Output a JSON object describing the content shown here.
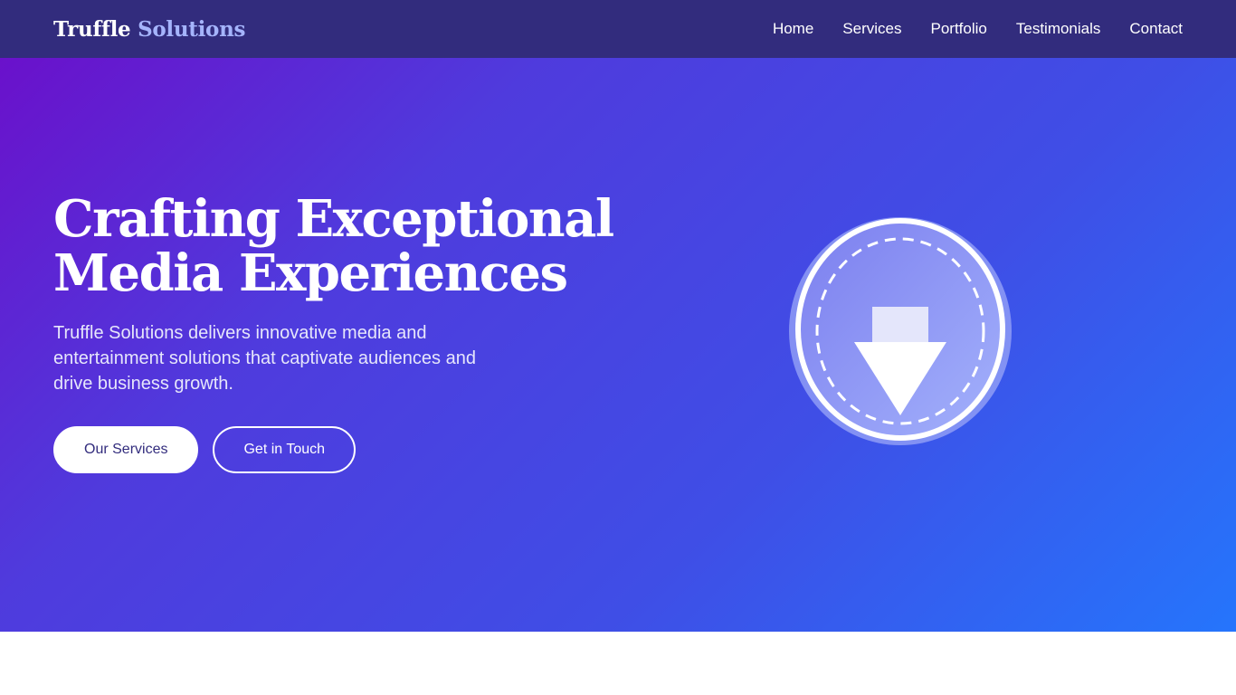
{
  "brand": {
    "name_main": "Truffle",
    "name_accent": "Solutions"
  },
  "nav": {
    "items": [
      {
        "label": "Home"
      },
      {
        "label": "Services"
      },
      {
        "label": "Portfolio"
      },
      {
        "label": "Testimonials"
      },
      {
        "label": "Contact"
      }
    ]
  },
  "hero": {
    "title_line1": "Crafting Exceptional",
    "title_line2": "Media Experiences",
    "subtitle": "Truffle Solutions delivers innovative media and entertainment solutions that captivate audiences and drive business growth.",
    "primary_cta": "Our Services",
    "secondary_cta": "Get in Touch",
    "emblem_icon": "play-down-triangle-icon"
  },
  "colors": {
    "navbar": "#322c7d",
    "brand_accent": "#a5b4fc",
    "hero_gradient_start": "#6a11cb",
    "hero_gradient_end": "#2575fc",
    "button_text": "#322c7d"
  }
}
